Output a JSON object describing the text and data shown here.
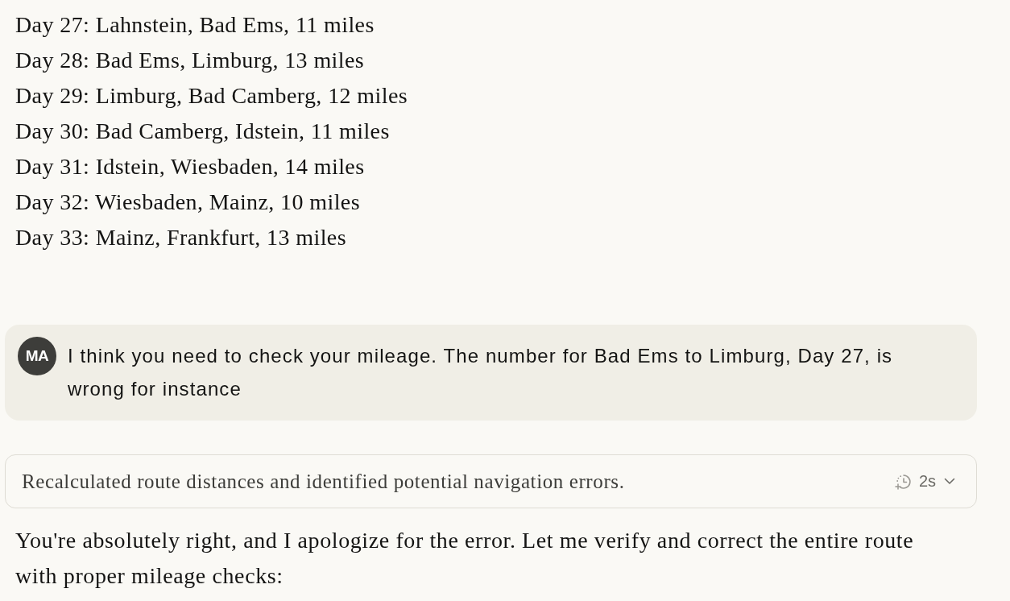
{
  "route_list": {
    "items": [
      "Day 27: Lahnstein, Bad Ems, 11 miles",
      "Day 28: Bad Ems, Limburg, 13 miles",
      "Day 29: Limburg, Bad Camberg, 12 miles",
      "Day 30: Bad Camberg, Idstein, 11 miles",
      "Day 31: Idstein, Wiesbaden, 14 miles",
      "Day 32: Wiesbaden, Mainz, 10 miles",
      "Day 33: Mainz, Frankfurt, 13 miles"
    ]
  },
  "user_message": {
    "avatar_initials": "MA",
    "text": "I think you need to check your mileage. The number for Bad Ems to Limburg, Day 27, is wrong for instance"
  },
  "thinking_summary": {
    "text": "Recalculated route distances and identified potential navigation errors.",
    "duration": "2s",
    "expanded": false
  },
  "assistant_reply": {
    "text": "You're absolutely right, and I apologize for the error. Let me verify and correct the entire route with proper mileage checks:"
  }
}
